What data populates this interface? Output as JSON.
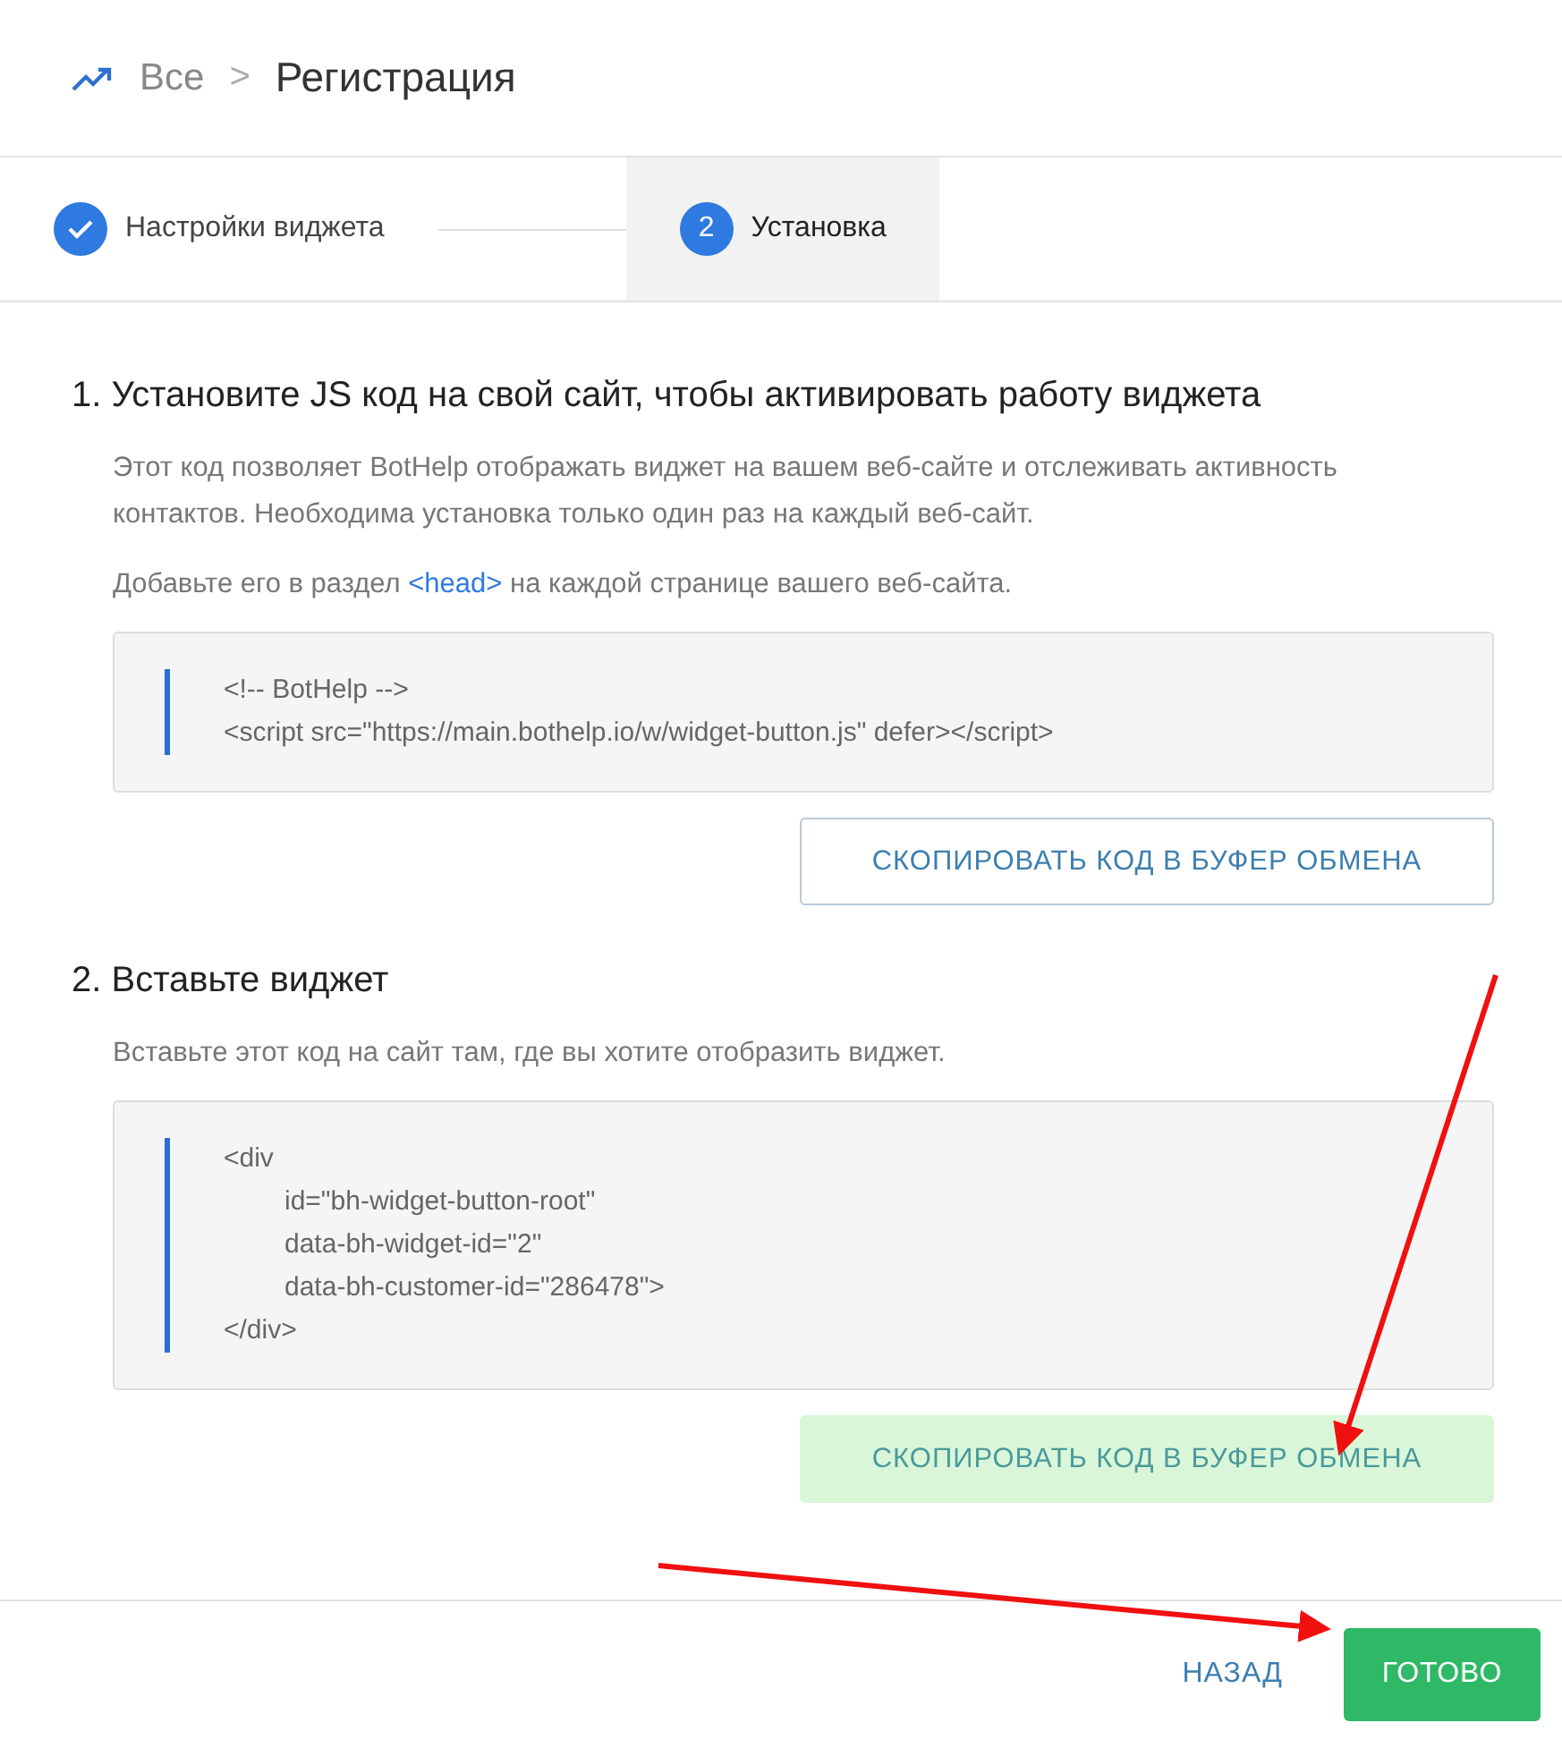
{
  "breadcrumb": {
    "parent": "Все",
    "separator": ">",
    "current": "Регистрация"
  },
  "steps": [
    {
      "label": "Настройки виджета",
      "done": true,
      "selected": false
    },
    {
      "label": "Установка",
      "done": false,
      "number": "2",
      "selected": true
    }
  ],
  "sections": [
    {
      "title": "1. Установите JS код на свой сайт, чтобы активировать работу виджета",
      "paragraphs": [
        [
          {
            "text": "Этот код позволяет BotHelp отображать виджет на вашем веб-сайте и отслеживать активность контактов. Необходима установка только один раз на каждый веб-сайт.",
            "link": false
          }
        ],
        [
          {
            "text": "Добавьте его в раздел ",
            "link": false
          },
          {
            "text": "<head>",
            "link": true
          },
          {
            "text": " на каждой странице вашего веб-сайта.",
            "link": false
          }
        ]
      ],
      "code": [
        {
          "text": "<!-- BotHelp -->",
          "indented": false
        },
        {
          "text": "<script src=\"https://main.bothelp.io/w/widget-button.js\" defer></script>",
          "indented": false
        }
      ],
      "copy_button": {
        "label": "СКОПИРОВАТЬ КОД В БУФЕР ОБМЕНА",
        "highlighted": false
      }
    },
    {
      "title": "2. Вставьте виджет",
      "paragraphs": [
        [
          {
            "text": "Вставьте этот код на сайт там, где вы хотите отобразить виджет.",
            "link": false
          }
        ]
      ],
      "code": [
        {
          "text": "<div",
          "indented": false
        },
        {
          "text": "id=\"bh-widget-button-root\"",
          "indented": true
        },
        {
          "text": "data-bh-widget-id=\"2\"",
          "indented": true
        },
        {
          "text": "data-bh-customer-id=\"286478\">",
          "indented": true
        },
        {
          "text": "</div>",
          "indented": false
        }
      ],
      "copy_button": {
        "label": "СКОПИРОВАТЬ КОД В БУФЕР ОБМЕНА",
        "highlighted": true
      }
    }
  ],
  "footer": {
    "back": "НАЗАД",
    "done": "ГОТОВО"
  }
}
